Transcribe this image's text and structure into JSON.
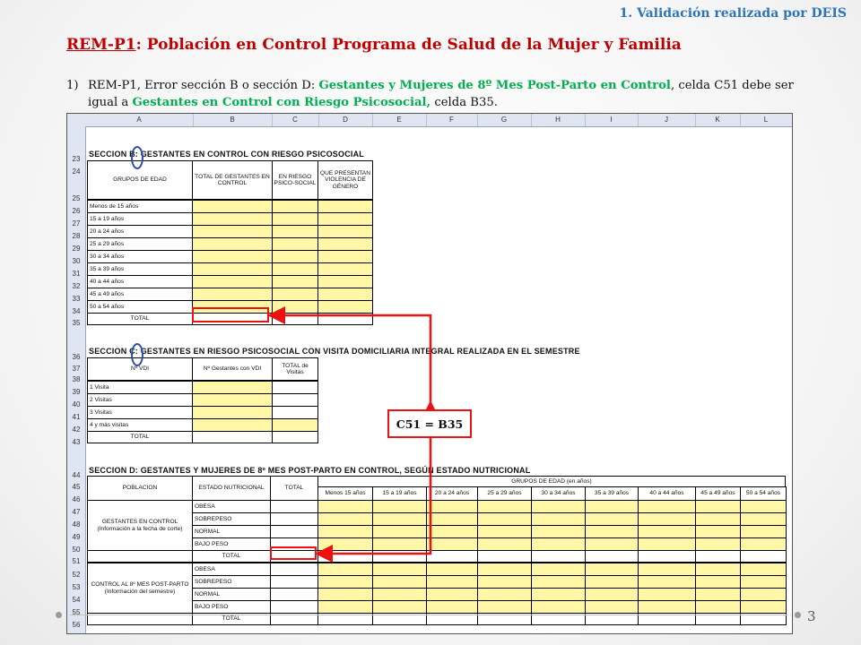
{
  "header_note": "1. Validación realizada por DEIS",
  "title": {
    "code": "REM-P1",
    "rest": ": Población en Control  Programa de Salud de la Mujer y Familia"
  },
  "item": {
    "number": "1)",
    "part1": "REM-P1, Error sección B o sección D: ",
    "part2_green": "Gestantes y Mujeres de 8º Mes Post-Parto en Control",
    "part3": ", celda C51 debe ser igual a ",
    "part4_green": "Gestantes en Control con Riesgo Psicosocial,",
    "part5": " celda B35."
  },
  "callout": "C51 = B35",
  "page_number": "3",
  "sheet": {
    "columns": [
      "A",
      "B",
      "C",
      "D",
      "E",
      "F",
      "G",
      "H",
      "I",
      "J",
      "K",
      "L"
    ],
    "section_b": {
      "title": "SECCION B: GESTANTES EN CONTROL  CON RIESGO PSICOSOCIAL",
      "headers": [
        "GRUPOS DE EDAD",
        "TOTAL DE GESTANTES EN CONTROL",
        "EN RIESGO PSICO-SOCIAL",
        "QUE PRESENTAN VIOLENCIA DE GÉNERO"
      ],
      "rows": [
        "Menos de 15 años",
        "15 a 19 años",
        "20 a 24 años",
        "25 a 29 años",
        "30 a 34 años",
        "35 a 39 años",
        "40 a 44 años",
        "45 a 49 años",
        "50 a 54 años"
      ],
      "total": "TOTAL"
    },
    "section_c": {
      "title": "SECCION C: GESTANTES EN RIESGO PSICOSOCIAL CON VISITA DOMICILIARIA INTEGRAL REALIZADA EN EL SEMESTRE",
      "headers": [
        "Nº VDI",
        "Nº Gestantes con VDI",
        "TOTAL de Visitas"
      ],
      "rows": [
        "1 Visita",
        "2 Visitas",
        "3 Visitas",
        "4 y más visitas"
      ],
      "total": "TOTAL"
    },
    "section_d": {
      "title": "SECCION D: GESTANTES Y  MUJERES DE 8º MES POST-PARTO EN CONTROL, SEGÚN ESTADO NUTRICIONAL",
      "headers": [
        "POBLACION",
        "ESTADO NUTRICIONAL",
        "TOTAL",
        "GRUPOS DE EDAD (en años)"
      ],
      "age_groups": [
        "Menos 15 años",
        "15 a 19 años",
        "20 a 24 años",
        "25 a 29 años",
        "30 a 34 años",
        "35 a 39 años",
        "40 a 44 años",
        "45 a 49 años",
        "50 a 54 años"
      ],
      "group1": "GESTANTES EN CONTROL (Información a la fecha de corte)",
      "group2": "CONTROL AL 8º MES POST-PARTO (Información del semestre)",
      "states": [
        "OBESA",
        "SOBREPESO",
        "NORMAL",
        "BAJO PESO"
      ],
      "total": "TOTAL"
    }
  }
}
